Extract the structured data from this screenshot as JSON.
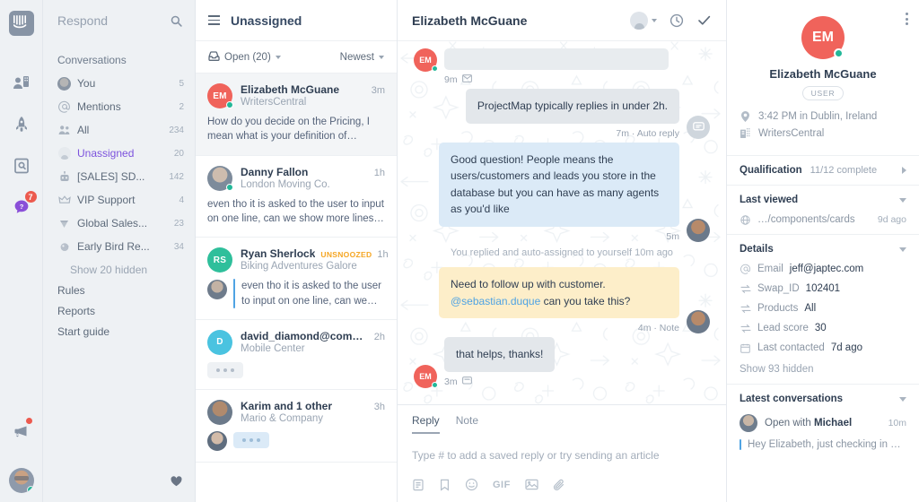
{
  "rail": {
    "logo": "intercom-logo",
    "icons": [
      {
        "name": "engage-icon"
      },
      {
        "name": "rocket-icon"
      },
      {
        "name": "articles-icon"
      },
      {
        "name": "messenger-icon",
        "badge": "7"
      }
    ],
    "announce": {
      "name": "megaphone-icon",
      "dot": true
    },
    "avatar": "current-user-avatar"
  },
  "nav": {
    "title": "Respond",
    "search_icon": "search-icon",
    "section": "Conversations",
    "items": [
      {
        "icon": "avatar-icon",
        "label": "You",
        "count": "5",
        "active": false
      },
      {
        "icon": "at-icon",
        "label": "Mentions",
        "count": "2",
        "active": false
      },
      {
        "icon": "people-icon",
        "label": "All",
        "count": "234",
        "active": false
      },
      {
        "icon": "unassigned-icon",
        "label": "Unassigned",
        "count": "20",
        "active": true
      },
      {
        "icon": "robot-icon",
        "label": "[SALES] SD...",
        "count": "142",
        "active": false
      },
      {
        "icon": "crown-icon",
        "label": "VIP Support",
        "count": "4",
        "active": false
      },
      {
        "icon": "diamond-icon",
        "label": "Global Sales...",
        "count": "23",
        "active": false
      },
      {
        "icon": "bird-icon",
        "label": "Early Bird Re...",
        "count": "34",
        "active": false
      }
    ],
    "show_hidden": "Show 20 hidden",
    "links": [
      "Rules",
      "Reports",
      "Start guide"
    ],
    "heart_icon": "heart-icon"
  },
  "list": {
    "menu_icon": "hamburger-icon",
    "title": "Unassigned",
    "filter": {
      "icon": "inbox-icon",
      "label": "Open (20)"
    },
    "sort": {
      "label": "Newest"
    },
    "conversations": [
      {
        "avatar_type": "initials",
        "initials": "EM",
        "avatar_color": "#f0635b",
        "online": true,
        "name": "Elizabeth McGuane",
        "time": "3m",
        "company": "WritersCentral",
        "preview": "How do you decide on the Pricing, I mean what is your definition of People? When…",
        "selected": true,
        "tag": "",
        "kind": "text"
      },
      {
        "avatar_type": "photo-a",
        "initials": "",
        "avatar_color": "",
        "online": true,
        "name": "Danny Fallon",
        "time": "1h",
        "company": "London Moving Co.",
        "preview": "even tho it is asked to the user to input on one line, can we show more lines of text…",
        "selected": false,
        "tag": "",
        "kind": "text"
      },
      {
        "avatar_type": "initials",
        "initials": "RS",
        "avatar_color": "#2fbf9b",
        "online": false,
        "name": "Ryan Sherlock",
        "time": "1h",
        "company": "Biking Adventures Galore",
        "preview": "even tho it is asked to the user to input on one line, can we show…",
        "selected": false,
        "tag": "UNSNOOZED",
        "kind": "note"
      },
      {
        "avatar_type": "initials",
        "initials": "D",
        "avatar_color": "#4ac3e0",
        "online": false,
        "name": "david_diamond@comp…",
        "time": "2h",
        "company": "Mobile Center",
        "preview": "",
        "selected": false,
        "tag": "",
        "kind": "typing"
      },
      {
        "avatar_type": "photo-b",
        "initials": "",
        "avatar_color": "",
        "online": false,
        "name": "Karim and 1 other",
        "time": "3h",
        "company": "Mario & Company",
        "preview": "",
        "selected": false,
        "tag": "",
        "kind": "typing-avatar"
      }
    ]
  },
  "thread": {
    "title": "Elizabeth McGuane",
    "actions": [
      {
        "name": "assignee-selector",
        "icon": "person-avatar-icon"
      },
      {
        "name": "snooze-button",
        "icon": "clock-icon"
      },
      {
        "name": "close-conversation-button",
        "icon": "check-icon"
      }
    ],
    "messages": [
      {
        "id": "m0",
        "side": "left",
        "style": "blank",
        "text": "",
        "meta": "9m",
        "meta_icon": "envelope-icon",
        "avatar": "EM"
      },
      {
        "id": "m1",
        "side": "right",
        "style": "grey",
        "text": "ProjectMap typically replies in under 2h.",
        "meta": "7m · Auto reply",
        "meta_icon": "",
        "avatar": "operator-bot"
      },
      {
        "id": "m2",
        "side": "right",
        "style": "blue",
        "text": "Good question! People means the users/customers and leads you store in the database but you can have as many agents as you'd like",
        "meta": "5m",
        "meta_icon": "",
        "avatar": "teammate-photo"
      },
      {
        "id": "sys",
        "side": "system",
        "style": "system",
        "text": "You replied and auto-assigned to yourself 10m ago",
        "meta": "",
        "meta_icon": "",
        "avatar": ""
      },
      {
        "id": "m3",
        "side": "right",
        "style": "note",
        "text": "Need to follow up with customer. ",
        "mention": "@sebastian.duque",
        "text_after": " can you take this?",
        "meta": "4m ·  Note",
        "meta_icon": "",
        "avatar": "teammate-photo"
      },
      {
        "id": "m4",
        "side": "left",
        "style": "grey",
        "text": "that helps, thanks!",
        "meta": "3m",
        "meta_icon": "messenger-icon",
        "avatar": "EM"
      }
    ],
    "composer": {
      "tabs": [
        {
          "label": "Reply",
          "active": true
        },
        {
          "label": "Note",
          "active": false
        }
      ],
      "placeholder": "Type # to add a saved reply or try sending an article",
      "tools": [
        {
          "name": "saved-reply-icon",
          "label": ""
        },
        {
          "name": "article-icon",
          "label": ""
        },
        {
          "name": "emoji-icon",
          "label": ""
        },
        {
          "name": "gif-icon",
          "label": "GIF"
        },
        {
          "name": "image-icon",
          "label": ""
        },
        {
          "name": "attachment-icon",
          "label": ""
        }
      ]
    }
  },
  "side": {
    "kebab_icon": "more-options-icon",
    "initials": "EM",
    "avatar_color": "#f0635b",
    "name": "Elizabeth McGuane",
    "role_pill": "USER",
    "facts": [
      {
        "icon": "location-pin-icon",
        "text": "3:42 PM in Dublin, Ireland"
      },
      {
        "icon": "company-icon",
        "text": "WritersCentral"
      }
    ],
    "qualification": {
      "title": "Qualification",
      "status": "11/12 complete"
    },
    "last_viewed": {
      "title": "Last viewed",
      "rows": [
        {
          "icon": "globe-icon",
          "label": "…/components/cards",
          "right": "9d ago"
        }
      ]
    },
    "details": {
      "title": "Details",
      "rows": [
        {
          "icon": "at-icon",
          "label": "Email",
          "value": "jeff@japtec.com"
        },
        {
          "icon": "attribute-icon",
          "label": "Swap_ID",
          "value": "102401"
        },
        {
          "icon": "attribute-icon",
          "label": "Products",
          "value": "All"
        },
        {
          "icon": "attribute-icon",
          "label": "Lead score",
          "value": "30"
        },
        {
          "icon": "calendar-icon",
          "label": "Last contacted",
          "value": "7d ago"
        }
      ],
      "show_hidden": "Show 93 hidden"
    },
    "latest_conversations": {
      "title": "Latest conversations",
      "items": [
        {
          "prefix": "Open with ",
          "who": "Michael",
          "time": "10m",
          "preview": "Hey Elizabeth, just checking in on…"
        }
      ]
    }
  }
}
